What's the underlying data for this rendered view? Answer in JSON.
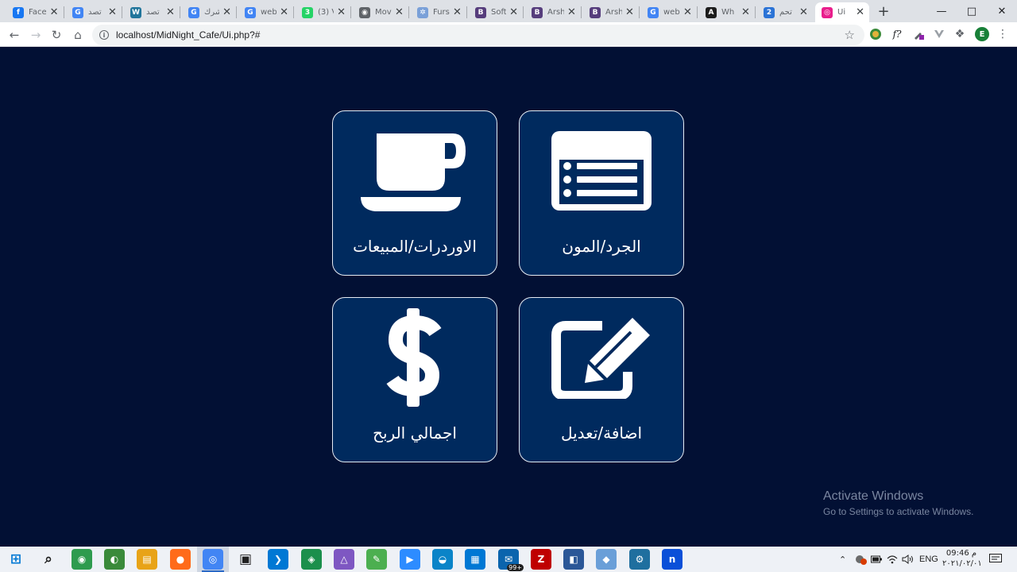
{
  "browser": {
    "tabs": [
      {
        "title": "Face",
        "icon": "facebook-icon",
        "color": "#1877f2",
        "glyph": "f"
      },
      {
        "title": "تصد",
        "icon": "google-icon",
        "color": "#4285f4",
        "glyph": "G"
      },
      {
        "title": "تصد",
        "icon": "wordpress-icon",
        "color": "#21759b",
        "glyph": "W"
      },
      {
        "title": "شرك",
        "icon": "google-icon",
        "color": "#4285f4",
        "glyph": "G"
      },
      {
        "title": "web",
        "icon": "google-icon",
        "color": "#4285f4",
        "glyph": "G"
      },
      {
        "title": "(3) V",
        "icon": "whatsapp-icon",
        "color": "#25d366",
        "glyph": "3"
      },
      {
        "title": "Mov",
        "icon": "eye-icon",
        "color": "#5f6368",
        "glyph": "◉"
      },
      {
        "title": "Furs",
        "icon": "gear-icon",
        "color": "#7aa0d8",
        "glyph": "✲"
      },
      {
        "title": "Soft",
        "icon": "bootstrap-icon",
        "color": "#563d7c",
        "glyph": "B"
      },
      {
        "title": "Arsh",
        "icon": "bootstrap-icon",
        "color": "#563d7c",
        "glyph": "B"
      },
      {
        "title": "Arsh",
        "icon": "bootstrap-icon",
        "color": "#563d7c",
        "glyph": "B"
      },
      {
        "title": "web",
        "icon": "google-icon",
        "color": "#4285f4",
        "glyph": "G"
      },
      {
        "title": "Wh",
        "icon": "unicorn-icon",
        "color": "#1c1c1c",
        "glyph": "A"
      },
      {
        "title": "تحم",
        "icon": "number-two-icon",
        "color": "#2b73d6",
        "glyph": "2"
      },
      {
        "title": "Ui",
        "icon": "ui-page-icon",
        "color": "#e91e8c",
        "glyph": "◎"
      }
    ],
    "active_tab": 14,
    "url": "localhost/MidNight_Cafe/Ui.php?#",
    "profile_initial": "E"
  },
  "cards": [
    {
      "label": "الاوردرات/المبيعات",
      "icon": "coffee-cup-icon"
    },
    {
      "label": "الجرد/المون",
      "icon": "list-icon"
    },
    {
      "label": "اجمالي الربح",
      "icon": "dollar-icon"
    },
    {
      "label": "اضافة/تعديل",
      "icon": "edit-icon"
    }
  ],
  "watermark": {
    "line1": "Activate Windows",
    "line2": "Go to Settings to activate Windows."
  },
  "taskbar": {
    "apps": [
      "windows-start-icon",
      "search-icon",
      "app-green-icon",
      "app-globe-icon",
      "file-explorer-icon",
      "firefox-icon",
      "chrome-icon",
      "terminal-icon",
      "vscode-icon",
      "app-android-icon",
      "visual-studio-icon",
      "app-paint-icon",
      "zoom-icon",
      "edge-icon",
      "store-icon",
      "mail-icon",
      "filezilla-icon",
      "app-box-icon",
      "app-cube-icon",
      "settings-icon",
      "app-n-icon"
    ],
    "mail_badge": "99+",
    "language": "ENG",
    "time": "09:46 م",
    "date": "٢٠٢١/٠٢/٠١"
  }
}
